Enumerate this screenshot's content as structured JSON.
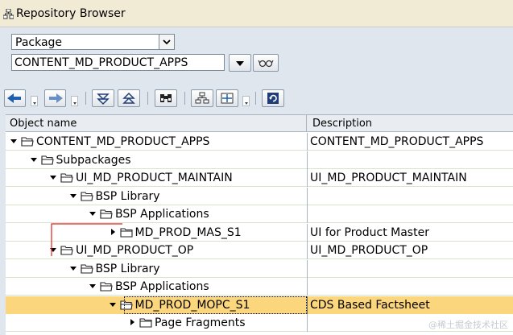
{
  "window": {
    "title": "Repository Browser",
    "icon": "hierarchy-icon"
  },
  "selector": {
    "object_type": "Package",
    "object_name": "CONTENT_MD_PRODUCT_APPS",
    "dropdown_icon": "triangle-down-icon",
    "display_icon": "glasses-icon"
  },
  "toolbar": {
    "icons": [
      "arrow-left-icon",
      "arrow-right-icon",
      "expand-all-icon",
      "collapse-all-icon",
      "binoculars-icon",
      "hierarchy-icon",
      "grid-select-icon",
      "refresh-icon"
    ]
  },
  "columns": {
    "name": "Object name",
    "description": "Description"
  },
  "tree": [
    {
      "name": "CONTENT_MD_PRODUCT_APPS",
      "description": "CONTENT_MD_PRODUCT_APPS",
      "depth": 0,
      "expanded": true,
      "icon": "folder-open-icon"
    },
    {
      "name": "Subpackages",
      "description": "",
      "depth": 1,
      "expanded": true,
      "icon": "folder-open-icon"
    },
    {
      "name": "UI_MD_PRODUCT_MAINTAIN",
      "description": "UI_MD_PRODUCT_MAINTAIN",
      "depth": 2,
      "expanded": true,
      "icon": "folder-open-icon"
    },
    {
      "name": "BSP Library",
      "description": "",
      "depth": 3,
      "expanded": true,
      "icon": "folder-open-icon"
    },
    {
      "name": "BSP Applications",
      "description": "",
      "depth": 4,
      "expanded": true,
      "icon": "folder-open-icon"
    },
    {
      "name": "MD_PROD_MAS_S1",
      "description": "UI for Product Master",
      "depth": 5,
      "expanded": false,
      "icon": "folder-closed-icon"
    },
    {
      "name": "UI_MD_PRODUCT_OP",
      "description": "UI_MD_PRODUCT_OP",
      "depth": 2,
      "expanded": true,
      "icon": "folder-open-icon"
    },
    {
      "name": "BSP Library",
      "description": "",
      "depth": 3,
      "expanded": true,
      "icon": "folder-open-icon"
    },
    {
      "name": "BSP Applications",
      "description": "",
      "depth": 4,
      "expanded": true,
      "icon": "folder-open-icon"
    },
    {
      "name": "MD_PROD_MOPC_S1",
      "description": "CDS Based Factsheet",
      "depth": 5,
      "expanded": true,
      "icon": "folder-open-icon",
      "selected": true
    },
    {
      "name": "Page Fragments",
      "description": "",
      "depth": 6,
      "expanded": false,
      "icon": "folder-closed-icon"
    }
  ],
  "watermark": "@稀土掘金技术社区",
  "colors": {
    "selected_row": "#fbd67c",
    "title_bar": "#f1ebd6",
    "background": "#dfe6ee",
    "annotation_line": "#e02020"
  }
}
